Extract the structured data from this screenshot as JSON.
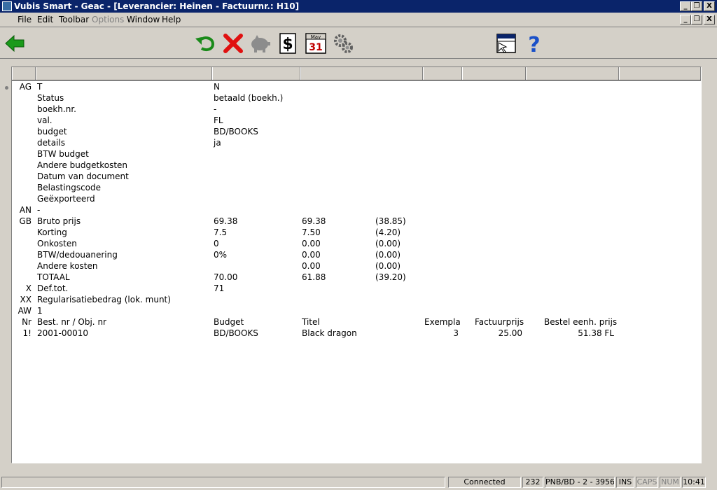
{
  "window": {
    "title": "Vubis Smart - Geac - [Leverancier: Heinen - Factuurnr.: H10]",
    "controls": [
      "_",
      "❒",
      "X"
    ]
  },
  "menu": {
    "file": "File",
    "edit": "Edit",
    "toolbar": "Toolbar",
    "options": "Options",
    "window": "Window",
    "help": "Help"
  },
  "toolbar": {
    "buttons": [
      "back-arrow-icon",
      "undo-icon",
      "delete-icon",
      "piggy-bank-icon",
      "dollar-icon",
      "calendar-icon",
      "settings-gears-icon",
      "window-layout-icon",
      "help-icon"
    ],
    "calendar_month": "May",
    "calendar_day": "31",
    "dollar": "$",
    "help": "?"
  },
  "colors": {
    "titlebar": "#0a246a",
    "back_arrow": "#1a9a1a",
    "delete": "#e01010",
    "help": "#1a50c8"
  },
  "rows": [
    {
      "tag": "AG",
      "label": "T",
      "v1": "N",
      "v2": "",
      "v3": ""
    },
    {
      "tag": "",
      "label": "Status",
      "v1": "betaald (boekh.)",
      "v2": "",
      "v3": ""
    },
    {
      "tag": "",
      "label": "boekh.nr.",
      "v1": "-",
      "v2": "",
      "v3": ""
    },
    {
      "tag": "",
      "label": "val.",
      "v1": "FL",
      "v2": "",
      "v3": ""
    },
    {
      "tag": "",
      "label": "budget",
      "v1": "BD/BOOKS",
      "v2": "",
      "v3": ""
    },
    {
      "tag": "",
      "label": "details",
      "v1": "ja",
      "v2": "",
      "v3": ""
    },
    {
      "tag": "",
      "label": "BTW budget",
      "v1": "",
      "v2": "",
      "v3": ""
    },
    {
      "tag": "",
      "label": "Andere budgetkosten",
      "v1": "",
      "v2": "",
      "v3": ""
    },
    {
      "tag": "",
      "label": "Datum van document",
      "v1": "",
      "v2": "",
      "v3": ""
    },
    {
      "tag": "",
      "label": "Belastingscode",
      "v1": "",
      "v2": "",
      "v3": ""
    },
    {
      "tag": "",
      "label": "Geëxporteerd",
      "v1": "",
      "v2": "",
      "v3": ""
    },
    {
      "tag": "AN",
      "label": "-",
      "v1": "",
      "v2": "",
      "v3": ""
    },
    {
      "tag": "GB",
      "label": "Bruto prijs",
      "v1": "69.38",
      "v2": "69.38",
      "v3": "(38.85)"
    },
    {
      "tag": "",
      "label": "Korting",
      "v1": "7.5",
      "v2": "7.50",
      "v3": "(4.20)"
    },
    {
      "tag": "",
      "label": "Onkosten",
      "v1": "0",
      "v2": "0.00",
      "v3": "(0.00)"
    },
    {
      "tag": "",
      "label": "BTW/dedouanering",
      "v1": "0%",
      "v2": "0.00",
      "v3": "(0.00)"
    },
    {
      "tag": "",
      "label": "Andere kosten",
      "v1": "",
      "v2": "0.00",
      "v3": "(0.00)"
    },
    {
      "tag": "",
      "label": "TOTAAL",
      "v1": "70.00",
      "v2": "61.88",
      "v3": "(39.20)"
    },
    {
      "tag": "X",
      "label": "Def.tot.",
      "v1": "71",
      "v2": "",
      "v3": ""
    },
    {
      "tag": "XX",
      "label": "Regularisatiebedrag (lok. munt)",
      "v1": "",
      "v2": "",
      "v3": ""
    },
    {
      "tag": "AW",
      "label": "1",
      "v1": "",
      "v2": "",
      "v3": ""
    }
  ],
  "lines_header": {
    "nr": "Nr",
    "best": "Best. nr / Obj. nr",
    "budget": "Budget",
    "titel": "Titel",
    "exempla": "Exempla",
    "factuurprijs": "Factuurprijs",
    "bestel": "Bestel eenh. prijs"
  },
  "lines": [
    {
      "nr": "1!",
      "best": "2001-00010",
      "budget": "BD/BOOKS",
      "titel": "Black dragon",
      "exempla": "3",
      "factuurprijs": "25.00",
      "bestel": "51.38 FL"
    }
  ],
  "status": {
    "connection": "Connected",
    "count": "232",
    "location": "PNB/BD - 2 - 3956",
    "ins": "INS",
    "caps": "CAPS",
    "num": "NUM",
    "time": "10:41"
  }
}
